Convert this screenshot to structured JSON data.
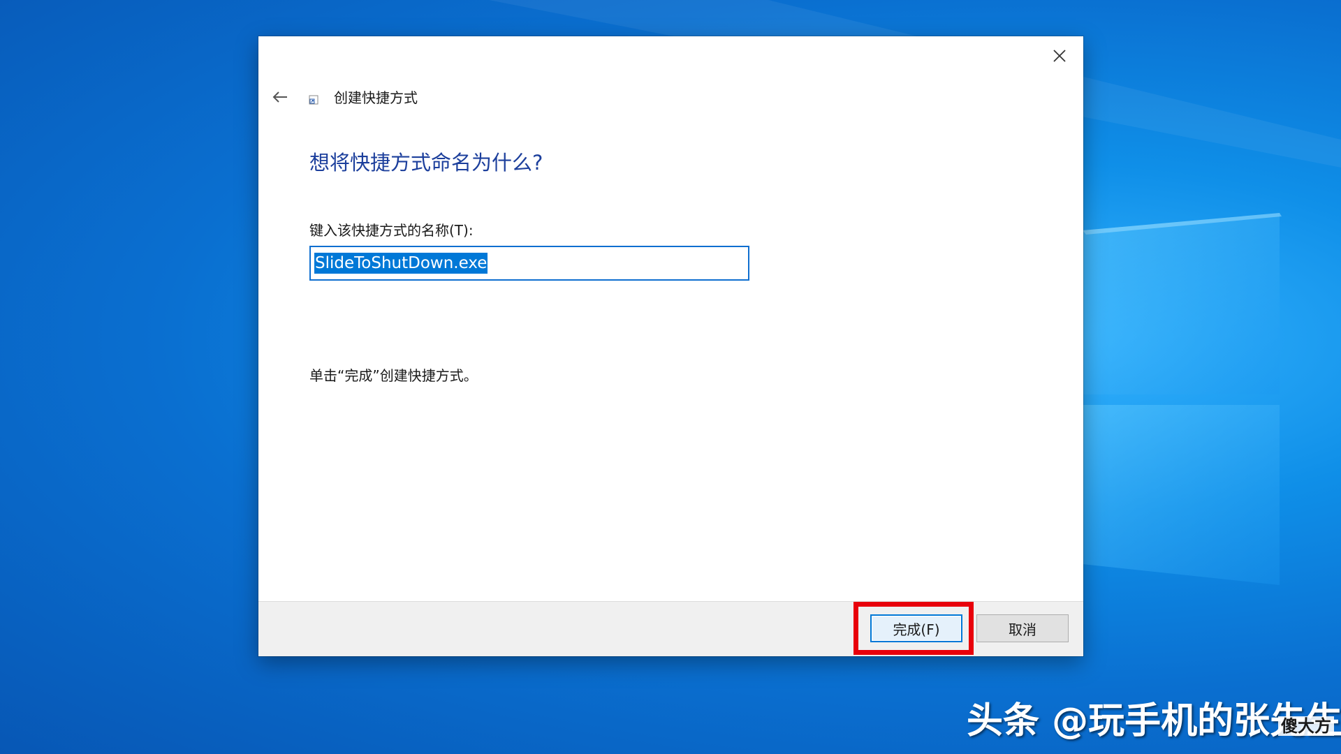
{
  "dialog": {
    "window_title": "创建快捷方式",
    "heading": "想将快捷方式命名为什么?",
    "field_label": "键入该快捷方式的名称(T):",
    "name_value": "SlideToShutDown.exe",
    "instruction": "单击“完成”创建快捷方式。",
    "buttons": {
      "finish": "完成(F)",
      "cancel": "取消"
    }
  },
  "icons": {
    "close": "close-icon",
    "back": "back-arrow-icon",
    "shortcut": "shortcut-icon"
  },
  "colors": {
    "heading": "#1c3f9c",
    "selection": "#0078d7",
    "highlight": "#e8000b",
    "desktop": "#0a6fd0"
  },
  "watermark": {
    "text": "头条 @玩手机的张先生",
    "badge": "傻大方"
  }
}
